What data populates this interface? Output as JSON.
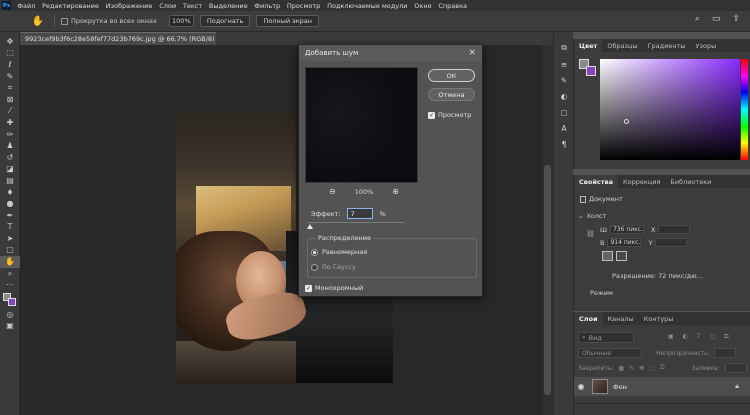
{
  "menu": {
    "logo": "Ps",
    "items": [
      "Файл",
      "Редактирование",
      "Изображение",
      "Слои",
      "Текст",
      "Выделение",
      "Фильтр",
      "Просмотр",
      "Подключаемые модули",
      "Окно",
      "Справка"
    ]
  },
  "options": {
    "scroll_all_label": "Прокрутка во всех окнах",
    "zoom_value": "100%",
    "fit_label": "Подогнать",
    "fullscreen_label": "Полный экран"
  },
  "document_tab": {
    "title": "9923cef9b3f6c28e58fef77d23b769c.jpg @ 66,7% (RGB/8) *",
    "close": "×"
  },
  "dialog": {
    "title": "Добавить шум",
    "close": "×",
    "ok": "ОК",
    "cancel": "Отмена",
    "preview_label": "Просмотр",
    "zoom_level": "100%",
    "effect_label": "Эффект:",
    "effect_value": "7",
    "effect_unit": "%",
    "distribution_label": "Распределение",
    "uniform_label": "Равномерная",
    "gaussian_label": "По Гауссу",
    "mono_label": "Монохромный"
  },
  "color_panel": {
    "tabs": [
      "Цвет",
      "Образцы",
      "Градиенты",
      "Узоры"
    ],
    "foreground": "#8a8a8a",
    "background": "#8a43c0"
  },
  "properties_panel": {
    "tabs": [
      "Свойства",
      "Коррекция",
      "Библиотеки"
    ],
    "document_label": "Документ",
    "canvas_label": "Холст",
    "width_label": "Ш",
    "width_value": "736 пикс.",
    "height_label": "В",
    "height_value": "914 пикс.",
    "x_label": "X",
    "y_label": "Y",
    "resolution": "Разрешение: 72 пикс/дю...",
    "mode_label": "Режим"
  },
  "layers_panel": {
    "tabs": [
      "Слои",
      "Каналы",
      "Контуры"
    ],
    "search_placeholder": "Вид",
    "blend_mode": "Обычные",
    "opacity_label": "Непрозрачность:",
    "lock_label": "Закрепить:",
    "fill_label": "Заливка:",
    "layer_name": "Фон"
  }
}
